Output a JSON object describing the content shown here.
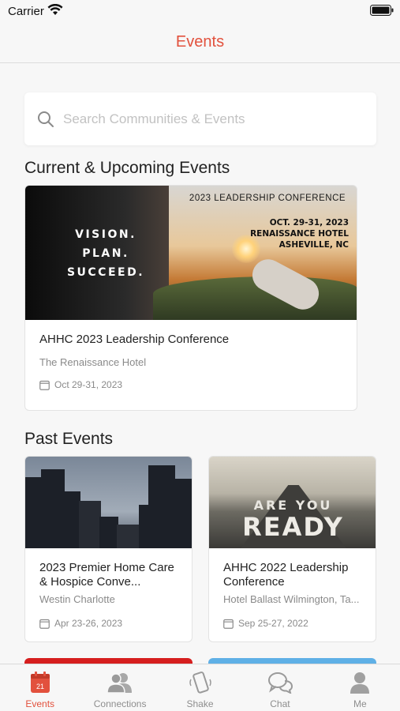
{
  "status_bar": {
    "carrier": "Carrier"
  },
  "nav": {
    "title": "Events"
  },
  "search": {
    "placeholder": "Search Communities & Events",
    "value": ""
  },
  "sections": {
    "current": "Current & Upcoming Events",
    "past": "Past Events"
  },
  "featured_event": {
    "banner_heading": "2023 LEADERSHIP CONFERENCE",
    "banner_date": "OCT. 29-31, 2023",
    "banner_venue": "RENAISSANCE HOTEL",
    "banner_city": "ASHEVILLE, NC",
    "banner_slogan_1": "VISION.",
    "banner_slogan_2": "PLAN.",
    "banner_slogan_3": "SUCCEED.",
    "title": "AHHC 2023 Leadership Conference",
    "venue": "The Renaissance Hotel",
    "date": "Oct 29-31, 2023"
  },
  "past_events": [
    {
      "title": "2023 Premier Home Care & Hospice Conve...",
      "venue": "Westin Charlotte",
      "date": "Apr 23-26, 2023"
    },
    {
      "title": "AHHC 2022 Leadership Conference",
      "venue": "Hotel Ballast Wilmington, Ta...",
      "date": "Sep 25-27, 2022",
      "banner_text_1": "ARE YOU",
      "banner_text_2": "READY"
    }
  ],
  "tabs": [
    {
      "label": "Events",
      "icon": "calendar-icon",
      "badge": "21",
      "active": true
    },
    {
      "label": "Connections",
      "icon": "people-icon",
      "active": false
    },
    {
      "label": "Shake",
      "icon": "phone-shake-icon",
      "active": false
    },
    {
      "label": "Chat",
      "icon": "chat-bubbles-icon",
      "active": false
    },
    {
      "label": "Me",
      "icon": "person-icon",
      "active": false
    }
  ],
  "colors": {
    "accent": "#e2513d",
    "background": "#f7f7f7",
    "muted_text": "#8a8a8a"
  }
}
